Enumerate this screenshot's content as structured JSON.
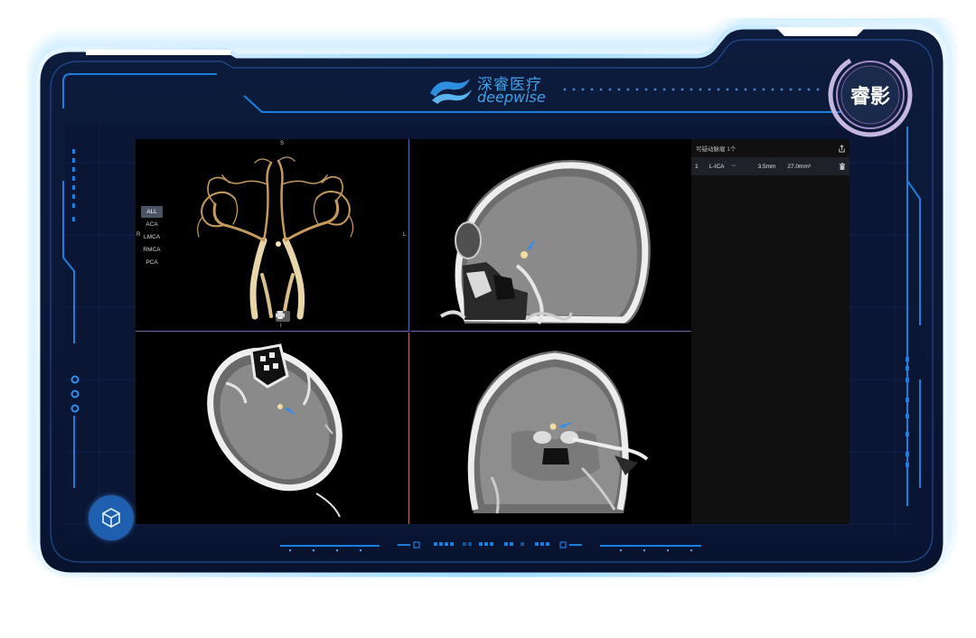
{
  "brand": {
    "cn_name": "深睿医疗",
    "en_name": "deepwise",
    "product_badge": "睿影"
  },
  "colors": {
    "frame_dark": "#0b1a3a",
    "accent_blue": "#1b7fe0",
    "glow": "#5fc2ff",
    "badge_ring": "#b7a7d6"
  },
  "viewer": {
    "orientation_3d": {
      "top": "S",
      "bottom": "I",
      "left": "R",
      "right": "L"
    },
    "vessel_filters": [
      "ALL",
      "ACA",
      "LMCA",
      "RMCA",
      "PCA"
    ],
    "active_filter": "ALL",
    "print_icon": "printer-icon"
  },
  "panel": {
    "title": "可疑动脉瘤 1个",
    "share_icon": "share-icon",
    "rows": [
      {
        "index": "1",
        "location": "L-ICA",
        "size": "3.5mm",
        "volume": "27.0mm³"
      }
    ],
    "delete_icon": "trash-icon"
  },
  "cube_button_icon": "cube-icon"
}
